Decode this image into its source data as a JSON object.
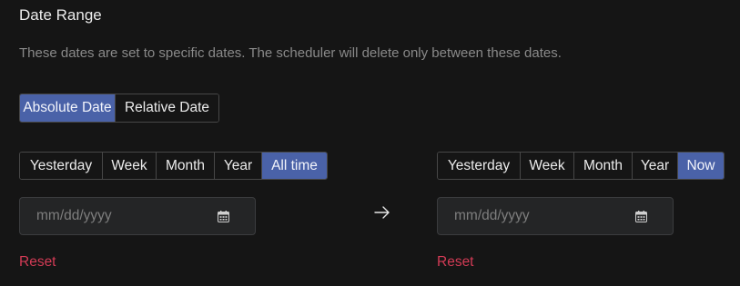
{
  "section": {
    "title": "Date Range",
    "description": "These dates are set to specific dates. The scheduler will delete only between these dates."
  },
  "mode": {
    "options": [
      "Absolute Date",
      "Relative Date"
    ],
    "selected": "Absolute Date"
  },
  "from": {
    "presets": [
      "Yesterday",
      "Week",
      "Month",
      "Year",
      "All time"
    ],
    "selected": "All time",
    "placeholder": "mm/dd/yyyy",
    "value": "",
    "reset_label": "Reset"
  },
  "to": {
    "presets": [
      "Yesterday",
      "Week",
      "Month",
      "Year",
      "Now"
    ],
    "selected": "Now",
    "placeholder": "mm/dd/yyyy",
    "value": "",
    "reset_label": "Reset"
  },
  "icons": {
    "calendar": "calendar-icon",
    "arrow": "arrow-right-icon"
  },
  "colors": {
    "background": "#151515",
    "accent": "#4a62a8",
    "danger": "#d23b55",
    "input_bg": "#242526",
    "muted_text": "#8a8a8a"
  }
}
